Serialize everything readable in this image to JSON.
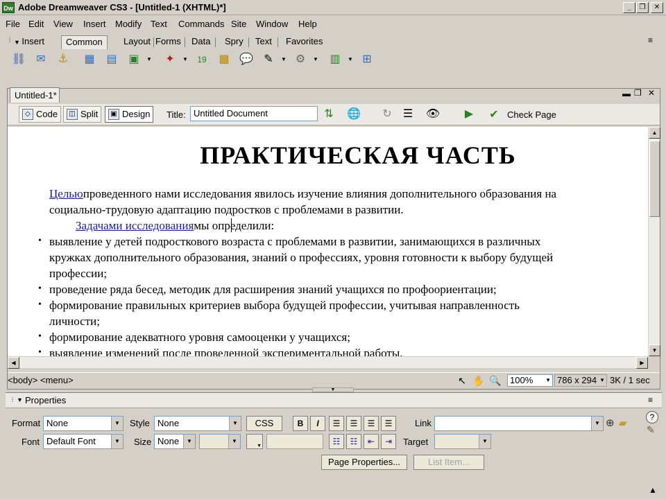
{
  "app": {
    "window_title": "Adobe Dreamweaver CS3 - [Untitled-1 (XHTML)*]",
    "logo": "Dw"
  },
  "menu": [
    "File",
    "Edit",
    "View",
    "Insert",
    "Modify",
    "Text",
    "Commands",
    "Site",
    "Window",
    "Help"
  ],
  "insert_bar": {
    "header": "Insert",
    "tabs": [
      "Common",
      "Layout",
      "Forms",
      "Data",
      "Spry",
      "Text",
      "Favorites"
    ],
    "active_tab": "Common",
    "icons": [
      "hyperlink-icon",
      "email-link-icon",
      "named-anchor-icon",
      "table-icon",
      "div-icon",
      "image-icon",
      "media-icon",
      "date-icon",
      "comment-icon",
      "head-icon",
      "script-icon",
      "templates-icon",
      "tag-chooser-icon",
      "server-icon"
    ]
  },
  "document": {
    "tab_label": "Untitled-1*",
    "view_buttons": [
      "Code",
      "Split",
      "Design"
    ],
    "active_view": "Design",
    "title_label": "Title:",
    "title_value": "Untitled Document",
    "check_page": "Check Page",
    "content": {
      "heading": "ПРАКТИЧЕСКАЯ ЧАСТЬ",
      "p1_link": "Целью",
      "p1_rest": "проведенного нами исследования явилось изучение влияния дополнительного образования на",
      "p1_line2": "социально-трудовую адаптацию подростков с проблемами в развитии.",
      "p2_link": "Задачами исследования",
      "p2_rest": "мы определили:",
      "bullets": [
        [
          "выявление у детей подросткового возраста с проблемами в развитии, занимающихся в различных",
          "кружках дополнительного образования, знаний о профессиях, уровня готовности к выбору будущей",
          "профессии;"
        ],
        [
          "проведение ряда бесед, методик для расширения знаний учащихся по профоориентации;"
        ],
        [
          "формирование правильных критериев выбора будущей профессии, учитывая направленность",
          "личности;"
        ],
        [
          "формирование адекватного уровня самооценки у учащихся;"
        ],
        [
          "выявление изменений после проведенной экспериментальной работы."
        ]
      ]
    }
  },
  "status": {
    "tag_selector": "<body> <menu>",
    "zoom": "100%",
    "window_size": "786 x 294",
    "download": "3K / 1 sec"
  },
  "properties": {
    "header": "Properties",
    "format_label": "Format",
    "format_value": "None",
    "style_label": "Style",
    "style_value": "None",
    "css_button": "CSS",
    "link_label": "Link",
    "link_value": "",
    "font_label": "Font",
    "font_value": "Default Font",
    "size_label": "Size",
    "size_value": "None",
    "target_label": "Target",
    "page_properties": "Page Properties...",
    "list_item": "List Item..."
  }
}
